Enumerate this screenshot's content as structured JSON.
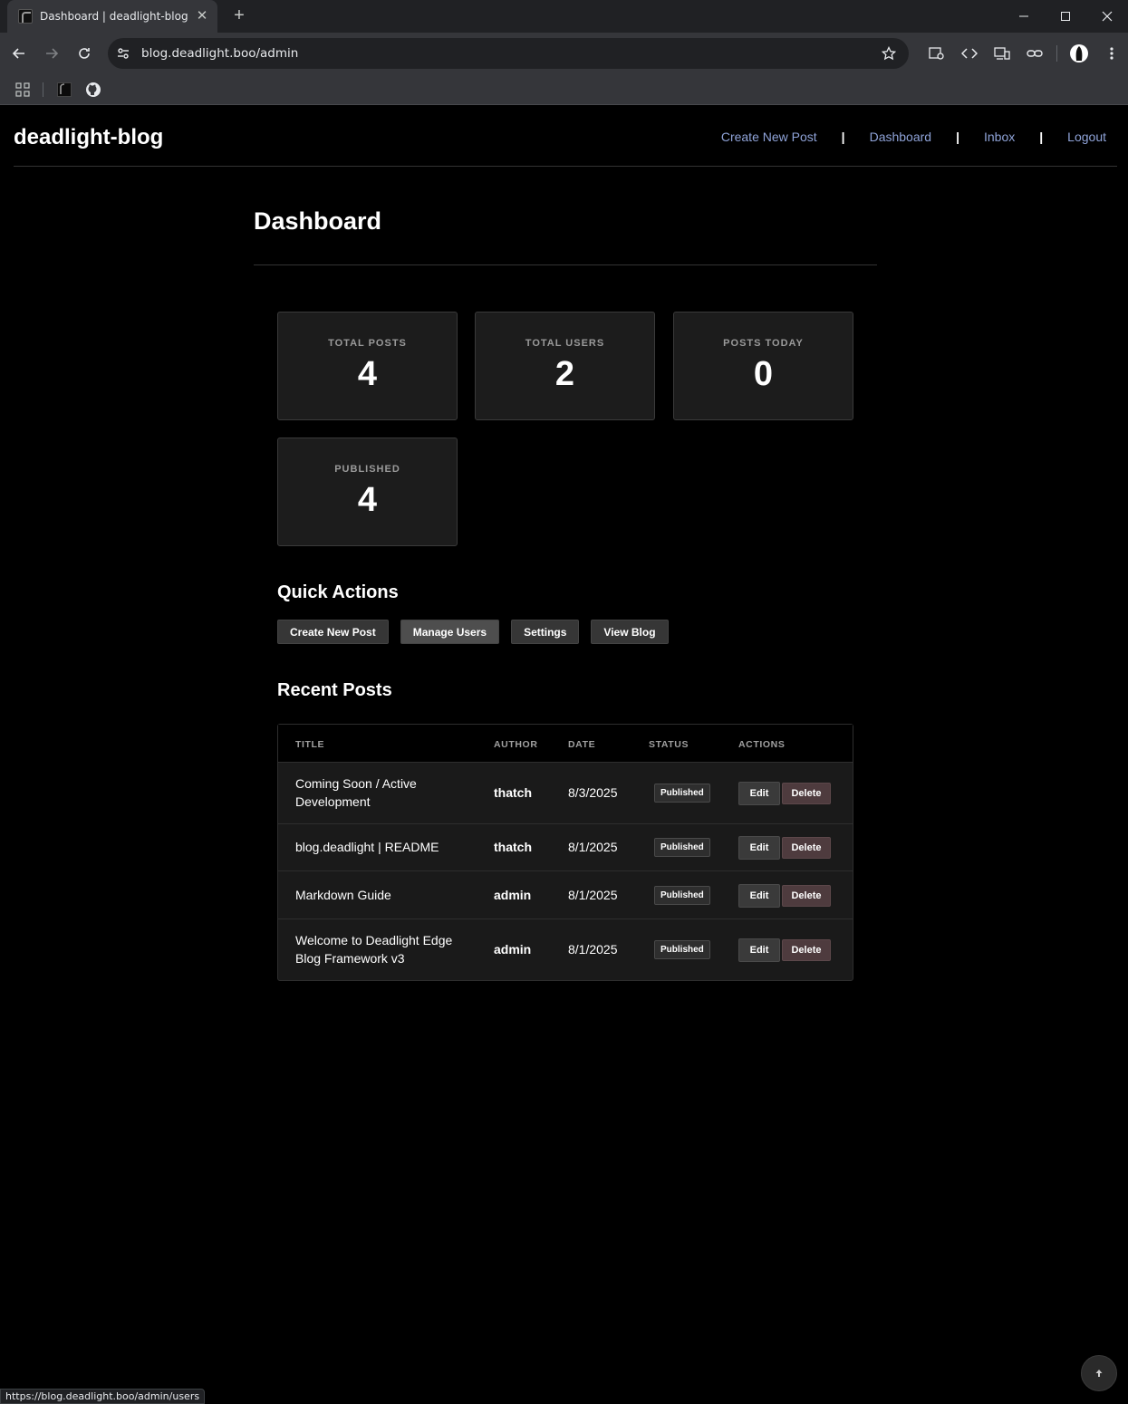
{
  "browser": {
    "tab_title": "Dashboard | deadlight-blog",
    "url": "blog.deadlight.boo/admin",
    "status_url": "https://blog.deadlight.boo/admin/users"
  },
  "site": {
    "brand": "deadlight-blog",
    "nav": [
      "Create New Post",
      "Dashboard",
      "Inbox",
      "Logout"
    ],
    "nav_separator": "|"
  },
  "dashboard": {
    "title": "Dashboard",
    "stats": [
      {
        "label": "TOTAL POSTS",
        "value": "4"
      },
      {
        "label": "TOTAL USERS",
        "value": "2"
      },
      {
        "label": "POSTS TODAY",
        "value": "0"
      },
      {
        "label": "PUBLISHED",
        "value": "4"
      }
    ],
    "quick_actions_title": "Quick Actions",
    "quick_actions": [
      "Create New Post",
      "Manage Users",
      "Settings",
      "View Blog"
    ],
    "recent_posts_title": "Recent Posts",
    "columns": [
      "TITLE",
      "AUTHOR",
      "DATE",
      "STATUS",
      "ACTIONS"
    ],
    "posts": [
      {
        "title": "Coming Soon / Active Development",
        "author": "thatch",
        "date": "8/3/2025",
        "status": "Published",
        "edit": "Edit",
        "delete": "Delete"
      },
      {
        "title": "blog.deadlight | README",
        "author": "thatch",
        "date": "8/1/2025",
        "status": "Published",
        "edit": "Edit",
        "delete": "Delete"
      },
      {
        "title": "Markdown Guide",
        "author": "admin",
        "date": "8/1/2025",
        "status": "Published",
        "edit": "Edit",
        "delete": "Delete"
      },
      {
        "title": "Welcome to Deadlight Edge Blog Framework v3",
        "author": "admin",
        "date": "8/1/2025",
        "status": "Published",
        "edit": "Edit",
        "delete": "Delete"
      }
    ]
  },
  "colors": {
    "link": "#8fa3d8",
    "delete_button": "#4e3b3e",
    "card_background": "#1c1c1c"
  }
}
